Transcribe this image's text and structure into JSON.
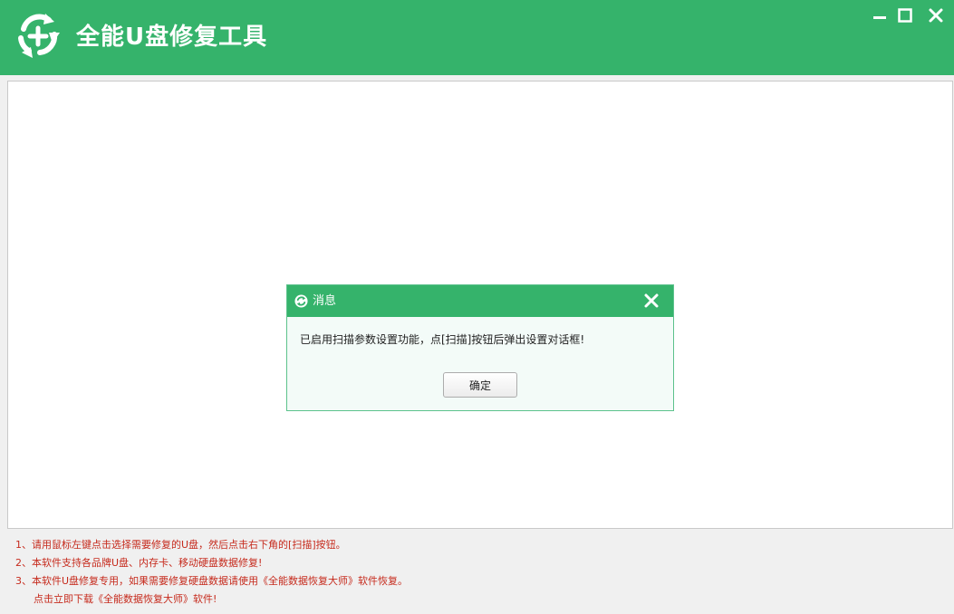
{
  "window": {
    "title": "全能U盘修复工具",
    "icons": {
      "logo": "refresh-plus-logo",
      "minimize": "minimize-icon",
      "maximize": "maximize-icon",
      "close": "close-icon"
    },
    "colors": {
      "accent": "#35b36b",
      "notice_text": "#c62a1c"
    }
  },
  "notes": [
    "1、请用鼠标左键点击选择需要修复的U盘，然后点击右下角的[扫描]按钮。",
    "2、本软件支持各品牌U盘、内存卡、移动硬盘数据修复!",
    "3、本软件U盘修复专用，如果需要修复硬盘数据请使用《全能数据恢复大师》软件恢复。",
    "点击立即下载《全能数据恢复大师》软件!"
  ],
  "dialog": {
    "title": "消息",
    "message": "已启用扫描参数设置功能，点[扫描]按钮后弹出设置对话框!",
    "ok_label": "确定",
    "icons": {
      "title": "refresh-icon",
      "close": "close-icon"
    }
  }
}
